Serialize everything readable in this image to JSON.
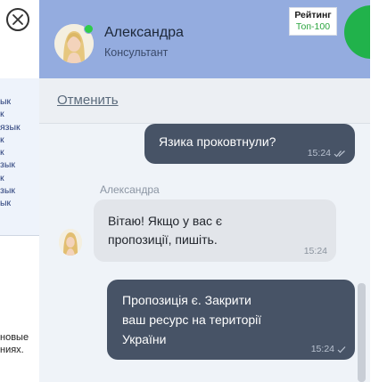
{
  "background_page": {
    "links": [
      "ык",
      "к",
      "язык",
      "к",
      "к",
      "зык",
      "к",
      "зык",
      "ык"
    ],
    "footer_lines": [
      "новые",
      "ниях."
    ]
  },
  "header": {
    "agent_name": "Александра",
    "agent_role": "Консультант",
    "rating_title": "Рейтинг",
    "rating_rank": "Топ-100"
  },
  "cancel_label": "Отменить",
  "messages": [
    {
      "direction": "out",
      "text": "Язика проковтнули?",
      "time": "15:24",
      "status": "read"
    },
    {
      "direction": "in",
      "sender": "Александра",
      "lines": [
        "Вітаю! Якщо у вас є",
        "пропозиції, пишіть."
      ],
      "time": "15:24"
    },
    {
      "direction": "out",
      "lines": [
        "Пропозиція є. Закрити",
        "ваш ресурс на території",
        "України"
      ],
      "time": "15:24",
      "status": "sent"
    }
  ],
  "colors": {
    "header_bg": "#94acdf",
    "outgoing_bubble": "#475366",
    "incoming_bubble": "#e2e5ea",
    "online_indicator": "#2ecc4a",
    "rating_accent": "#2aa53e"
  },
  "icons": {
    "close": "close-icon",
    "read_status": "double-check-icon",
    "sent_status": "check-icon"
  }
}
